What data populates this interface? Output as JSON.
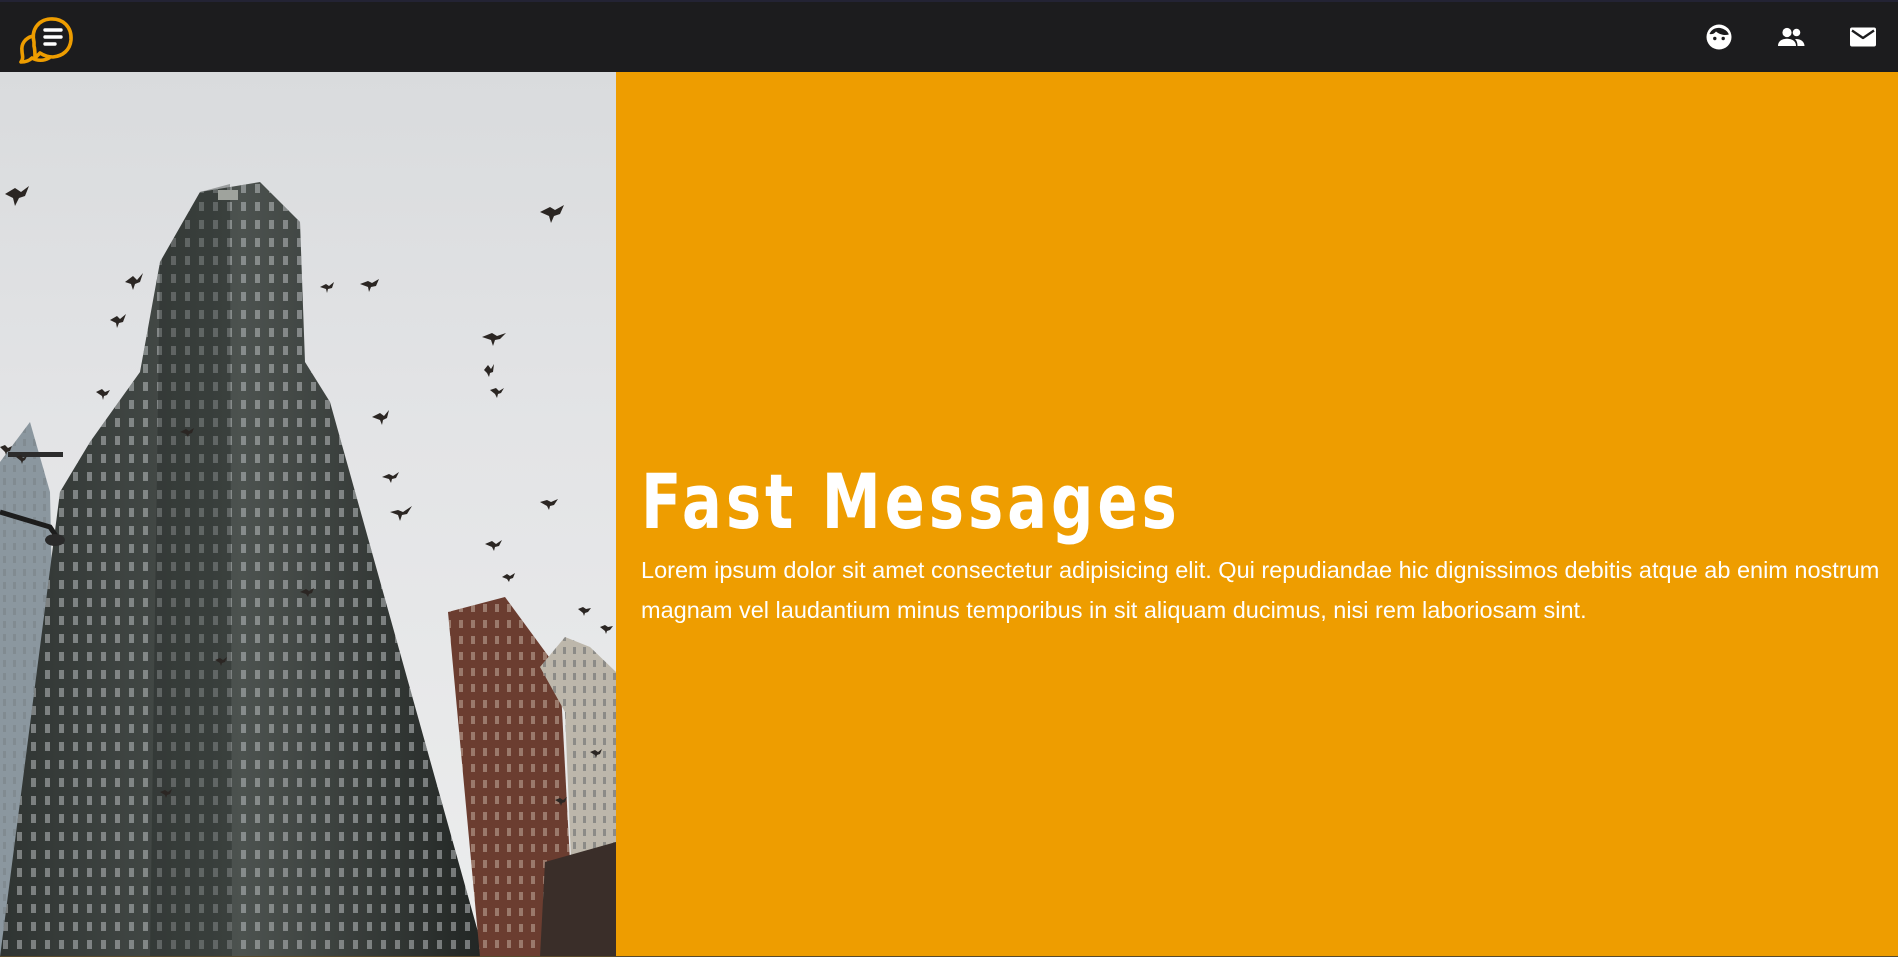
{
  "navbar": {
    "logo_icon": "chat-bubble-menu-icon",
    "icons": [
      "face-icon",
      "group-icon",
      "mail-icon"
    ]
  },
  "hero": {
    "image_icon": "skyscraper-birds-photo",
    "title": "Fast Messages",
    "text": "Lorem ipsum dolor sit amet consectetur adipisicing elit. Qui repudiandae hic dignissimos debitis atque ab enim nostrum magnam vel laudantium minus temporibus in sit aliquam ducimus, nisi rem laboriosam sint."
  },
  "colors": {
    "navbar": "#1c1c1e",
    "accent": "#ee9d00",
    "text": "#ffffff"
  }
}
